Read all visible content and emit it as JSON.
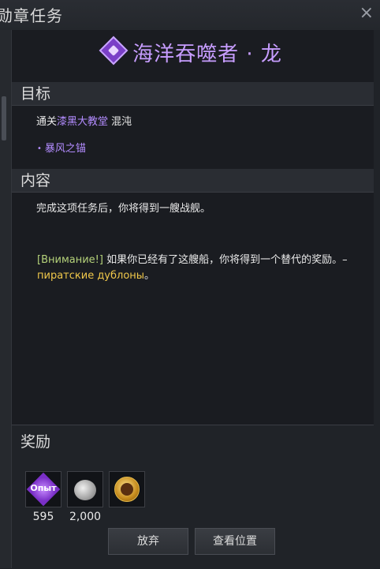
{
  "window": {
    "title": "勋章任务",
    "close_icon": "×"
  },
  "quest": {
    "title": "海洋吞噬者 · 龙"
  },
  "objective": {
    "heading": "目标",
    "line_prefix": "通关",
    "location": "漆黑大教堂",
    "difficulty": "混沌",
    "item": "暴风之锚"
  },
  "content": {
    "heading": "内容",
    "description": "完成这项任务后，你将得到一艘战舰。",
    "notice_label": "[Внимание!]",
    "notice_text": "如果你已经有了这艘船，你将得到一个替代的奖励。–",
    "notice_reward": "пиратские дублоны",
    "notice_end": "。"
  },
  "rewards": {
    "heading": "奖励",
    "items": [
      {
        "label": "Опыт",
        "count": "595",
        "icon": "exp-gem-icon"
      },
      {
        "label": "",
        "count": "2,000",
        "icon": "silver-coins-icon"
      },
      {
        "label": "",
        "count": "",
        "icon": "ship-medal-icon"
      }
    ]
  },
  "buttons": {
    "abandon": "放弃",
    "view_location": "查看位置"
  }
}
